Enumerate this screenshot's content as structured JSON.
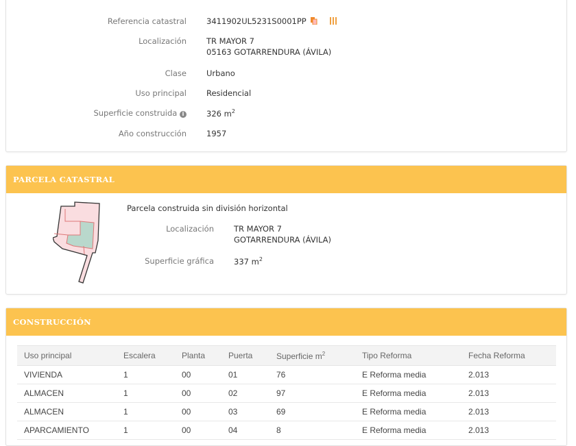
{
  "inmueble": {
    "rows": [
      {
        "label": "Referencia catastral",
        "value": "3411902UL5231S0001PP"
      },
      {
        "label": "Localización",
        "value": "TR MAYOR 7",
        "value2": "05163 GOTARRENDURA (ÁVILA)"
      },
      {
        "label": "Clase",
        "value": "Urbano"
      },
      {
        "label": "Uso principal",
        "value": "Residencial"
      },
      {
        "label": "Superficie construida",
        "value": "326 m",
        "unit_sup": "2"
      },
      {
        "label": "Año construcción",
        "value": "1957"
      }
    ]
  },
  "parcela": {
    "title": "PARCELA CATASTRAL",
    "description": "Parcela construida sin división horizontal",
    "loc_label": "Localización",
    "loc_value": "TR MAYOR 7",
    "loc_value2": "GOTARRENDURA (ÁVILA)",
    "sup_label": "Superficie gráfica",
    "sup_value": "337 m",
    "sup_sup": "2"
  },
  "construccion": {
    "title": "CONSTRUCCIÓN",
    "headers": [
      "Uso principal",
      "Escalera",
      "Planta",
      "Puerta",
      "Superficie m",
      "Tipo Reforma",
      "Fecha Reforma"
    ],
    "header_sup": "2",
    "rows": [
      [
        "VIVIENDA",
        "1",
        "00",
        "01",
        "76",
        "E Reforma media",
        "2.013"
      ],
      [
        "ALMACEN",
        "1",
        "00",
        "02",
        "97",
        "E Reforma media",
        "2.013"
      ],
      [
        "ALMACEN",
        "1",
        "00",
        "03",
        "69",
        "E Reforma media",
        "2.013"
      ],
      [
        "APARCAMIENTO",
        "1",
        "00",
        "04",
        "8",
        "E Reforma media",
        "2.013"
      ]
    ]
  },
  "colors": {
    "accent": "#fcc34f",
    "icon": "#f0892a"
  }
}
